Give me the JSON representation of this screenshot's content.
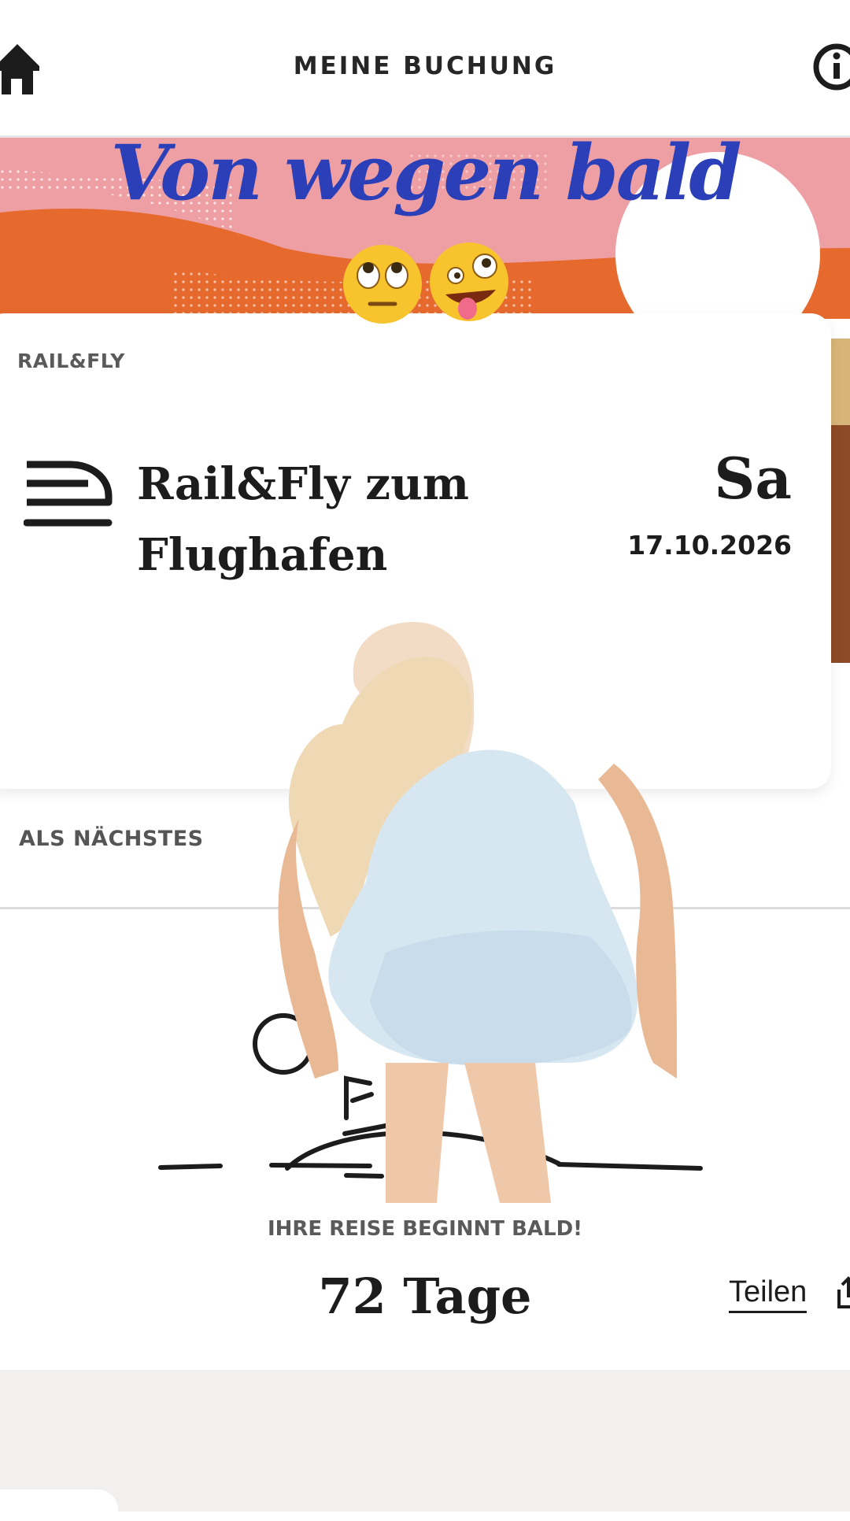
{
  "header": {
    "title": "MEINE BUCHUNG",
    "home_icon": "home-icon",
    "info_icon": "info-icon"
  },
  "overlay": {
    "caption": "Von wegen bald",
    "emojis": [
      "face-with-rolling-eyes",
      "zany-face"
    ]
  },
  "booking": {
    "label": "RAIL&FLY",
    "icon": "train-icon",
    "title": "Rail&Fly zum Flughafen",
    "day": "Sa",
    "date": "17.10.2026"
  },
  "next": {
    "label": "ALS NÄCHSTES",
    "journey_label": "IHRE REISE BEGINNT BALD!",
    "days": "72 Tage",
    "share_label": "Teilen",
    "share_icon": "share-icon"
  },
  "colors": {
    "banner_pink": "#ee9fa4",
    "banner_orange": "#e66a2e",
    "caption_blue": "#2a3fb8",
    "strip_brown": "#8c4a26"
  }
}
